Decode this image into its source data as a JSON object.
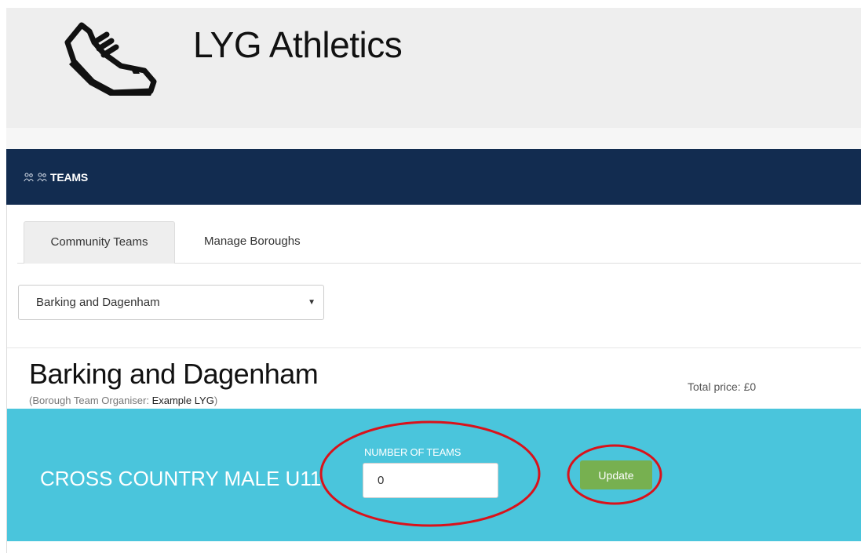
{
  "app": {
    "title": "LYG Athletics",
    "logo_icon": "running-shoe-icon"
  },
  "panel": {
    "title": "TEAMS",
    "icons": [
      "users-icon",
      "users-icon"
    ]
  },
  "tabs": [
    {
      "label": "Community Teams",
      "active": true
    },
    {
      "label": "Manage Boroughs",
      "active": false
    }
  ],
  "borough_select": {
    "value": "Barking and Dagenham"
  },
  "borough": {
    "name": "Barking and Dagenham",
    "organiser_prefix": "(Borough Team Organiser: ",
    "organiser_name": "Example LYG",
    "organiser_suffix": ")",
    "total_price": "Total price: £0"
  },
  "event": {
    "title": "CROSS COUNTRY MALE U11",
    "teams_label": "NUMBER OF TEAMS",
    "teams_value": "0",
    "update_label": "Update"
  },
  "colors": {
    "panel_header": "#122c50",
    "event_band": "#4ac5dc",
    "update_button": "#77b050",
    "annotation": "#d9121b"
  }
}
